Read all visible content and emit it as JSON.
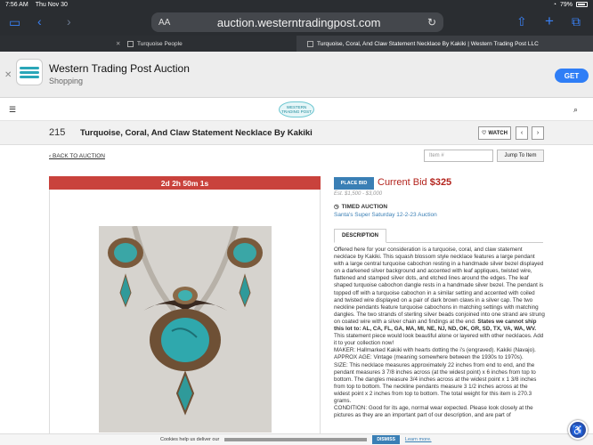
{
  "status": {
    "time": "7:56 AM",
    "date": "Thu Nov 30",
    "battery": "79%"
  },
  "browser": {
    "aa": "AA",
    "host": "auction.westerntradingpost.com",
    "tabs": [
      {
        "label": "Turquoise People"
      },
      {
        "label": "Turquoise, Coral, And Claw Statement Necklace By Kakiki | Western Trading Post LLC"
      }
    ]
  },
  "banner": {
    "app_name": "Western Trading Post Auction",
    "category": "Shopping",
    "get_label": "GET"
  },
  "site": {
    "brand_text": "WESTERN TRADING POST"
  },
  "lot": {
    "number": "215",
    "title": "Turquoise, Coral, And Claw Statement Necklace By Kakiki",
    "watch_label": "WATCH",
    "back_label": "BACK TO AUCTION",
    "item_placeholder": "Item #",
    "jump_label": "Jump To Item",
    "timer": "2d 2h 50m 1s",
    "place_bid_label": "PLACE BID",
    "current_bid_label": "Current Bid",
    "current_bid_value": "$325",
    "estimate": "Est. $1,500 - $3,000",
    "timed_label": "TIMED AUCTION",
    "event_name": "Santa's Super Saturday 12-2-23 Auction",
    "desc_tab": "DESCRIPTION",
    "desc_p1": "Offered here for your consideration is a turquoise, coral, and claw statement necklace by Kakiki. This squash blossom style necklace features a large pendant with a large central turquoise cabochon resting in a handmade silver bezel displayed on a darkened silver background and accented with leaf appliques, twisted wire, flattened and stamped silver dots, and etched lines around the edges. The leaf shaped turquoise cabochon dangle rests in a handmade silver bezel. The pendant is topped off with a turquoise cabochon in a similar setting and accented with coiled and twisted wire displayed on a pair of dark brown claws in a silver cap. The two neckline pendants feature turquoise cabochons in matching settings with matching dangles. The two strands of sterling silver beads conjoined into one strand are strung on coated wire with a silver chain and findings at the end.",
    "desc_bold": "States we cannot ship this lot to: AL, CA, FL, GA, MA, MI, NE, NJ, ND, OK, OR, SD, TX, VA, WA, WV.",
    "desc_p2": "This statement piece would look beautiful alone or layered with other necklaces. Add it to your collection now!",
    "maker": "MAKER: Hallmarked Kakiki with hearts dotting the i's (engraved). Kakiki (Navajo).",
    "age": "APPROX AGE: Vintage (meaning somewhere between the 1930s to 1970s).",
    "size": "SIZE: This necklace measures approximately 22 inches from end to end, and the pendant measures 3 7/8 inches across (at the widest point) x 6 inches from top to bottom. The dangles measure 3/4 inches across at the widest point x 1 3/8 inches from top to bottom. The neckline pendants measure 3 1/2 inches across at the widest point x 2 inches from top to bottom. The total weight for this item is 270.3 grams.",
    "condition": "CONDITION: Good for its age, normal wear expected. Please look closely at the pictures as they are an important part of our description, and are part of"
  },
  "cookie": {
    "lead": "Cookies help us deliver our",
    "dismiss": "DISMISS",
    "learn": "Learn more."
  }
}
